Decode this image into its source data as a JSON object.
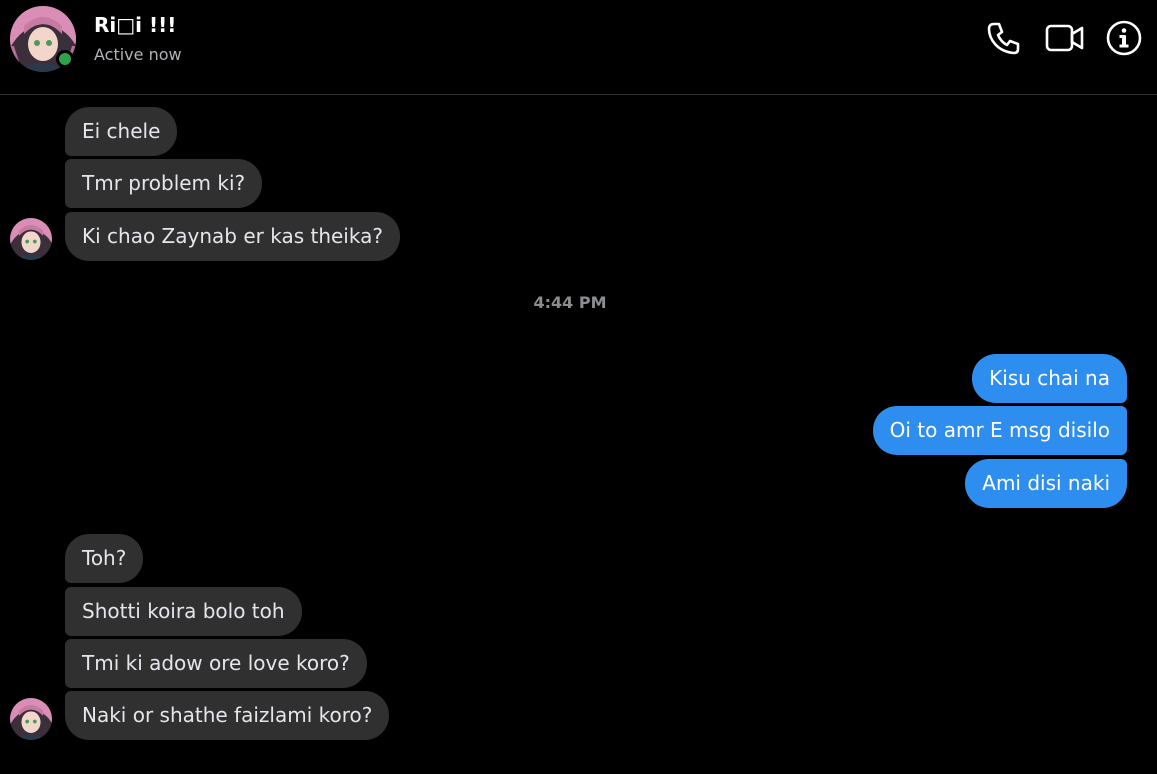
{
  "header": {
    "name": "Ri□i !!!",
    "status": "Active now",
    "icons": {
      "call": "phone-icon",
      "video": "video-camera-icon",
      "info": "info-icon"
    },
    "online_color": "#31a24c"
  },
  "colors": {
    "background": "#000000",
    "incoming_bubble": "#303030",
    "outgoing_bubble": "#2e8ef0",
    "timestamp": "#8a8d91"
  },
  "messages": {
    "group1": [
      "Ei chele",
      "Tmr problem ki?",
      "Ki chao Zaynab er kas theika?"
    ],
    "timestamp": "4:44 PM",
    "group2": [
      "Kisu chai na",
      "Oi to amr E msg disilo",
      "Ami disi naki"
    ],
    "group3": [
      "Toh?",
      "Shotti koira bolo toh",
      "Tmi ki adow ore love koro?",
      "Naki or shathe faizlami koro?"
    ]
  }
}
